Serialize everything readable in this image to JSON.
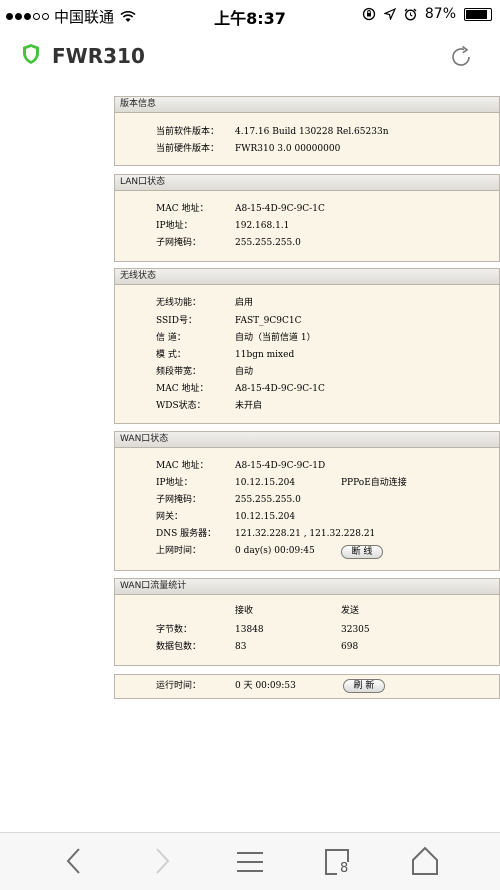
{
  "status_bar": {
    "carrier": "中国联通",
    "time": "上午8:37",
    "battery": "87%",
    "battery_level": 0.87
  },
  "header": {
    "title": "FWR310"
  },
  "sections": {
    "version": {
      "title": "版本信息",
      "sw_label": "当前软件版本：",
      "sw_value": "4.17.16 Build 130228 Rel.65233n",
      "hw_label": "当前硬件版本：",
      "hw_value": "FWR310 3.0 00000000"
    },
    "lan": {
      "title": "LAN口状态",
      "mac_label": "MAC 地址：",
      "mac_value": "A8-15-4D-9C-9C-1C",
      "ip_label": "IP地址：",
      "ip_value": "192.168.1.1",
      "mask_label": "子网掩码：",
      "mask_value": "255.255.255.0"
    },
    "wireless": {
      "title": "无线状态",
      "func_label": "无线功能：",
      "func_value": "启用",
      "ssid_label": "SSID号：",
      "ssid_value": "FAST_9C9C1C",
      "channel_label": "信 道：",
      "channel_value": "自动（当前信道 1）",
      "mode_label": "模 式：",
      "mode_value": "11bgn mixed",
      "bw_label": "频段带宽：",
      "bw_value": "自动",
      "mac_label": "MAC 地址：",
      "mac_value": "A8-15-4D-9C-9C-1C",
      "wds_label": "WDS状态：",
      "wds_value": "未开启"
    },
    "wan": {
      "title": "WAN口状态",
      "mac_label": "MAC 地址：",
      "mac_value": "A8-15-4D-9C-9C-1D",
      "ip_label": "IP地址：",
      "ip_value": "10.12.15.204",
      "conn_type": "PPPoE自动连接",
      "mask_label": "子网掩码：",
      "mask_value": "255.255.255.0",
      "gw_label": "网关：",
      "gw_value": "10.12.15.204",
      "dns_label": "DNS 服务器：",
      "dns_value": "121.32.228.21 , 121.32.228.21",
      "uptime_label": "上网时间：",
      "uptime_value": "0 day(s) 00:09:45",
      "disconnect_label": "断 线"
    },
    "traffic": {
      "title": "WAN口流量统计",
      "recv_header": "接收",
      "send_header": "发送",
      "bytes_label": "字节数：",
      "bytes_recv": "13848",
      "bytes_send": "32305",
      "packets_label": "数据包数：",
      "packets_recv": "83",
      "packets_send": "698"
    },
    "runtime": {
      "label": "运行时间：",
      "value": "0 天 00:09:53",
      "refresh_label": "刷 新"
    }
  },
  "toolbar": {
    "tab_count": "8",
    "icons": [
      "back-icon",
      "forward-icon",
      "menu-icon",
      "tabs-icon",
      "home-icon"
    ]
  }
}
